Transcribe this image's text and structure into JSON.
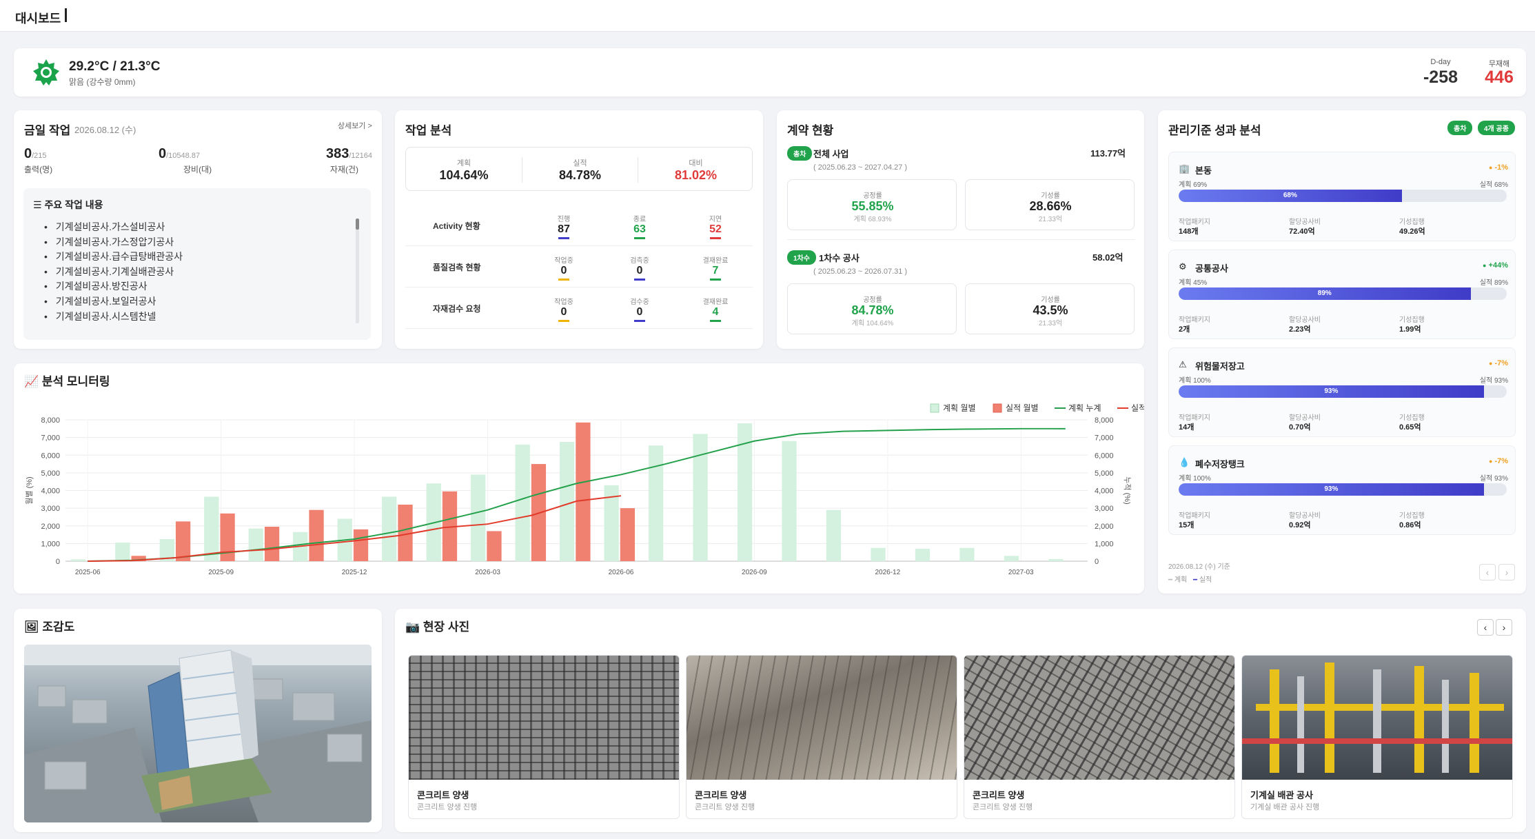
{
  "header": {
    "title": "대시보드"
  },
  "weather": {
    "temp": "29.2°C / 21.3°C",
    "desc": "맑음 (강수량 0mm)",
    "dday_label": "D-day",
    "dday_value": "-258",
    "safe_label": "무재해",
    "safe_value": "446"
  },
  "today": {
    "title": "금일 작업",
    "date": "2026.08.12 (수)",
    "more": "상세보기 >",
    "stats": [
      {
        "value": "0",
        "total": "/215",
        "label": "출력(명)"
      },
      {
        "value": "0",
        "total": "/10548.87",
        "label": "장비(대)"
      },
      {
        "value": "383",
        "total": "/12164",
        "label": "자재(건)"
      }
    ],
    "list_title": "주요 작업 내용",
    "items": [
      "기계설비공사.가스설비공사",
      "기계설비공사.가스정압기공사",
      "기계설비공사.급수급탕배관공사",
      "기계설비공사.기계실배관공사",
      "기계설비공사.방진공사",
      "기계설비공사.보일러공사",
      "기계설비공사.시스템찬넬"
    ]
  },
  "work": {
    "title": "작업 분석",
    "plan_label": "계획",
    "plan": "104.64%",
    "actual_label": "실적",
    "actual": "84.78%",
    "ratio_label": "대비",
    "ratio": "81.02%",
    "rows": [
      {
        "name": "Activity 현황",
        "c": [
          {
            "l": "진행",
            "v": "87"
          },
          {
            "l": "종료",
            "v": "63"
          },
          {
            "l": "지연",
            "v": "52"
          }
        ]
      },
      {
        "name": "품질검측 현황",
        "c": [
          {
            "l": "작업중",
            "v": "0"
          },
          {
            "l": "검측중",
            "v": "0"
          },
          {
            "l": "결재완료",
            "v": "7"
          }
        ]
      },
      {
        "name": "자재검수 요청",
        "c": [
          {
            "l": "작업중",
            "v": "0"
          },
          {
            "l": "검수중",
            "v": "0"
          },
          {
            "l": "결재완료",
            "v": "4"
          }
        ]
      }
    ]
  },
  "contract": {
    "title": "계약 현황",
    "blocks": [
      {
        "badge": "총차",
        "name": "전체 사업",
        "amount": "113.77억",
        "period": "( 2025.06.23 ~ 2027.04.27 )",
        "rate_label": "공정률",
        "rate": "55.85%",
        "rate_plan": "계획 68.93%",
        "gi_label": "기성률",
        "gi": "28.66%",
        "gi_amt": "21.33억"
      },
      {
        "badge": "1차수",
        "name": "1차수 공사",
        "amount": "58.02억",
        "period": "( 2025.06.23 ~ 2026.07.31 )",
        "rate_label": "공정률",
        "rate": "84.78%",
        "rate_plan": "계획 104.64%",
        "gi_label": "기성률",
        "gi": "43.5%",
        "gi_amt": "21.33억"
      }
    ]
  },
  "mgmt": {
    "title": "관리기준 성과 분석",
    "badge1": "총차",
    "badge2": "4개 공종",
    "footer_date": "2026.08.12 (수) 기준",
    "legend_plan": "계획",
    "legend_actual": "실적",
    "items": [
      {
        "name": "본동",
        "icon": "building-icon",
        "delta": "-1%",
        "delta_color": "#f0a020",
        "plan": "계획 69%",
        "actual": "실적 68%",
        "pct": 68,
        "pct_label": "68%",
        "k1": "작업패키지",
        "v1": "148개",
        "k2": "할당공사비",
        "v2": "72.40억",
        "k3": "기성집행",
        "v3": "49.26억"
      },
      {
        "name": "공통공사",
        "icon": "gear-icon",
        "delta": "+44%",
        "delta_color": "#20a34b",
        "plan": "계획 45%",
        "actual": "실적 89%",
        "pct": 89,
        "pct_label": "89%",
        "k1": "작업패키지",
        "v1": "2개",
        "k2": "할당공사비",
        "v2": "2.23억",
        "k3": "기성집행",
        "v3": "1.99억"
      },
      {
        "name": "위험물저장고",
        "icon": "warning-icon",
        "delta": "-7%",
        "delta_color": "#f0a020",
        "plan": "계획 100%",
        "actual": "실적 93%",
        "pct": 93,
        "pct_label": "93%",
        "k1": "작업패키지",
        "v1": "14개",
        "k2": "할당공사비",
        "v2": "0.70억",
        "k3": "기성집행",
        "v3": "0.65억"
      },
      {
        "name": "폐수저장탱크",
        "icon": "droplet-icon",
        "delta": "-7%",
        "delta_color": "#f0a020",
        "plan": "계획 100%",
        "actual": "실적 93%",
        "pct": 93,
        "pct_label": "93%",
        "k1": "작업패키지",
        "v1": "15개",
        "k2": "할당공사비",
        "v2": "0.92억",
        "k3": "기성집행",
        "v3": "0.86억"
      }
    ]
  },
  "chart_title": "분석 모니터링",
  "chart_data": {
    "type": "bar",
    "x": [
      "2025-06",
      "2025-07",
      "2025-08",
      "2025-09",
      "2025-10",
      "2025-11",
      "2025-12",
      "2026-01",
      "2026-02",
      "2026-03",
      "2026-04",
      "2026-05",
      "2026-06",
      "2026-07",
      "2026-08",
      "2026-09",
      "2026-10",
      "2026-11",
      "2026-12",
      "2027-01",
      "2027-02",
      "2027-03",
      "2027-04"
    ],
    "xticks": [
      "2025-06",
      "2025-09",
      "2025-12",
      "2026-03",
      "2026-06",
      "2026-09",
      "2026-12",
      "2027-03"
    ],
    "series": [
      {
        "name": "계획 월별",
        "color": "#d3f1de",
        "values": [
          100,
          1050,
          1250,
          3650,
          1850,
          1650,
          2400,
          3650,
          4400,
          4900,
          6600,
          6750,
          4300,
          6550,
          7200,
          7800,
          6800,
          2900,
          750,
          700,
          750,
          300,
          120
        ]
      },
      {
        "name": "실적 월별",
        "color": "#f08070",
        "values": [
          0,
          300,
          2250,
          2700,
          1950,
          2900,
          1800,
          3200,
          3950,
          1700,
          5500,
          7850,
          3000
        ]
      },
      {
        "name": "계획 누계",
        "color": "#22a04a",
        "values": [
          0,
          50,
          200,
          450,
          700,
          1000,
          1250,
          1700,
          2300,
          2900,
          3700,
          4400,
          4900,
          5500,
          6150,
          6800,
          7200,
          7350,
          7400,
          7450,
          7480,
          7500,
          7500
        ]
      },
      {
        "name": "실적 누계",
        "color": "#e23a2a",
        "values": [
          0,
          30,
          200,
          500,
          650,
          900,
          1150,
          1450,
          1900,
          2100,
          2600,
          3400,
          3700
        ]
      }
    ],
    "yleft": {
      "label": "월별 (%)",
      "min": 0,
      "max": 8000,
      "ticks": [
        "0",
        "1,000",
        "2,000",
        "3,000",
        "4,000",
        "5,000",
        "6,000",
        "7,000",
        "8,000"
      ]
    },
    "yright": {
      "label": "누적 (%)",
      "min": 0,
      "max": 8000,
      "ticks": [
        "0",
        "1,000",
        "2,000",
        "3,000",
        "4,000",
        "5,000",
        "6,000",
        "7,000",
        "8,000"
      ]
    },
    "grid": true,
    "legend": "top-right"
  },
  "aerial": {
    "title": "조감도"
  },
  "photos": {
    "title": "현장 사진",
    "items": [
      {
        "cap": "콘크리트 양생",
        "sub": "콘크리트 양생 진행"
      },
      {
        "cap": "콘크리트 양생",
        "sub": "콘크리트 양생 진행"
      },
      {
        "cap": "콘크리트 양생",
        "sub": "콘크리트 양생 진행"
      },
      {
        "cap": "기계실 배관 공사",
        "sub": "기계실 배관 공사 진행"
      }
    ]
  },
  "colors": {
    "green": "#20a34b",
    "red": "#e03a3a",
    "blue": "#3f3cc8",
    "orange": "#f0a020"
  }
}
